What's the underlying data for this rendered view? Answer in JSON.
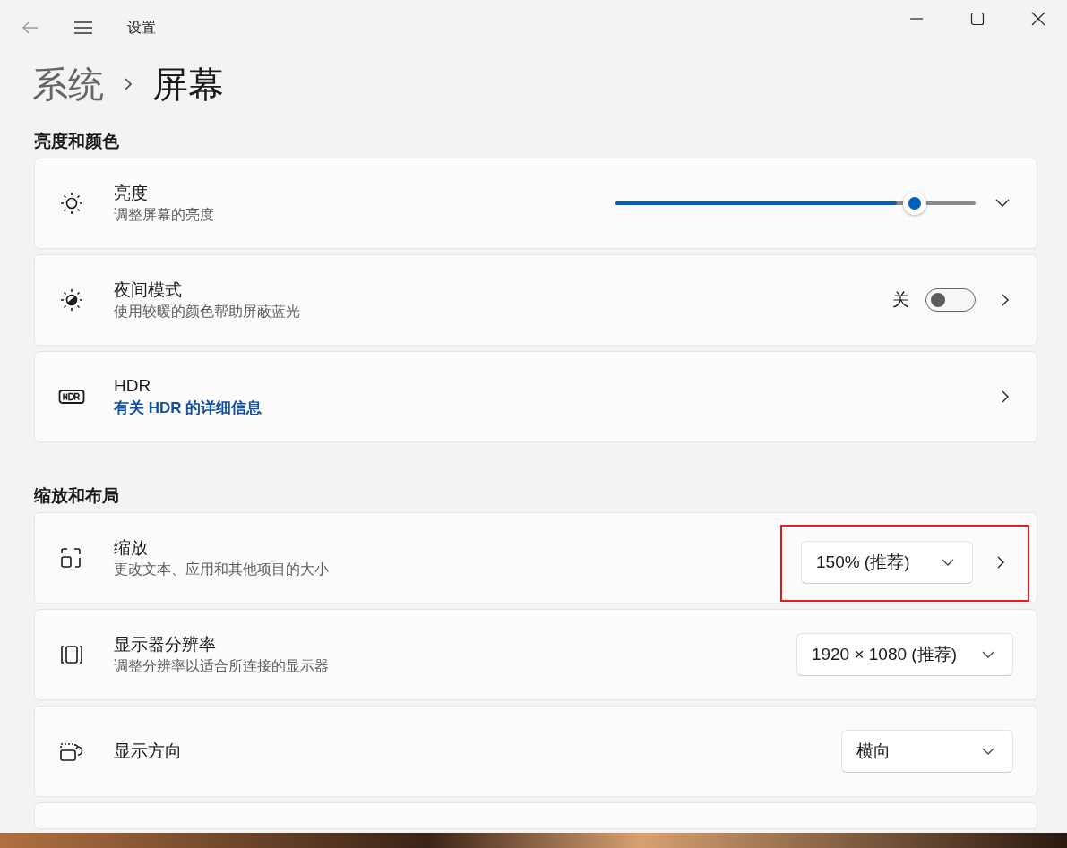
{
  "window": {
    "title": "设置"
  },
  "breadcrumb": [
    {
      "label": "系统",
      "selected": false
    },
    {
      "label": "屏幕",
      "selected": true
    }
  ],
  "sections": [
    {
      "title": "亮度和颜色",
      "rows": [
        {
          "kind": "slider",
          "title": "亮度",
          "subtitle": "调整屏幕的亮度",
          "level": 0.78,
          "expanded": false
        },
        {
          "kind": "toggle",
          "title": "夜间模式",
          "subtitle": "使用较暖的颜色帮助屏蔽蓝光",
          "state_label": "关",
          "on": false
        },
        {
          "kind": "link",
          "title": "HDR",
          "link": "有关 HDR 的详细信息"
        }
      ]
    },
    {
      "title": "缩放和布局",
      "rows": [
        {
          "kind": "dropdown",
          "title": "缩放",
          "subtitle": "更改文本、应用和其他项目的大小",
          "value": "150% (推荐)",
          "more": true,
          "highlighted": true
        },
        {
          "kind": "dropdown",
          "title": "显示器分辨率",
          "subtitle": "调整分辨率以适合所连接的显示器",
          "value": "1920 × 1080 (推荐)",
          "more": false,
          "highlighted": false
        },
        {
          "kind": "dropdown",
          "title": "显示方向",
          "value": "横向",
          "more": false,
          "highlighted": false
        }
      ]
    }
  ]
}
